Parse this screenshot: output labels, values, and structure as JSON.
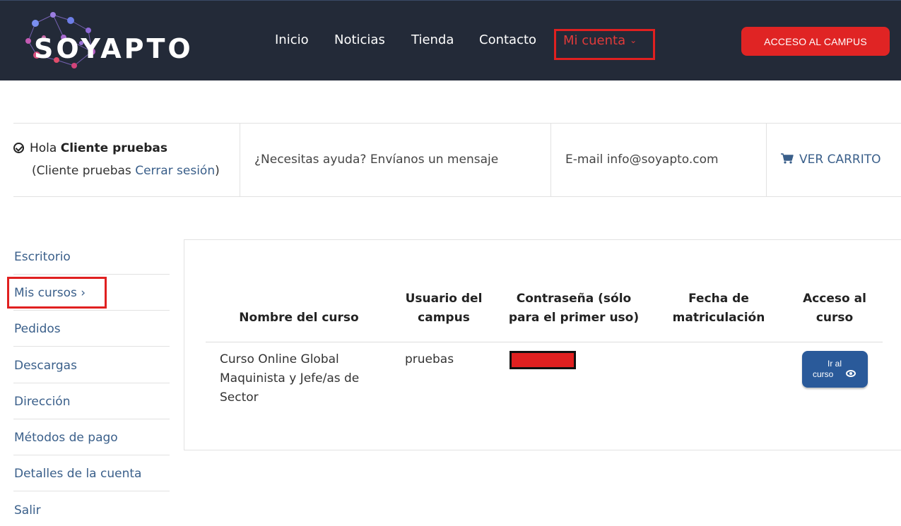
{
  "header": {
    "logo_text": "SOYAPTO",
    "nav": [
      "Inicio",
      "Noticias",
      "Tienda",
      "Contacto"
    ],
    "account_label": "Mi cuenta",
    "campus_button": "ACCESO AL CAMPUS",
    "colors": {
      "background": "#232a38",
      "accent": "#e02424"
    }
  },
  "infobar": {
    "hello_prefix": "Hola",
    "user_name": "Cliente pruebas",
    "sub_prefix": "(Cliente pruebas",
    "logout_link": "Cerrar sesión",
    "sub_suffix": ")",
    "help_text": "¿Necesitas ayuda? Envíanos un mensaje",
    "email_text": "E-mail info@soyapto.com",
    "cart_label": "VER CARRITO"
  },
  "sidebar": {
    "items": [
      {
        "label": "Escritorio"
      },
      {
        "label": "Mis cursos ›"
      },
      {
        "label": "Pedidos"
      },
      {
        "label": "Descargas"
      },
      {
        "label": "Dirección"
      },
      {
        "label": "Métodos de pago"
      },
      {
        "label": "Detalles de la cuenta"
      },
      {
        "label": "Salir"
      }
    ]
  },
  "table": {
    "headers": [
      {
        "line1": "Nombre del curso",
        "line2": ""
      },
      {
        "line1": "Usuario del",
        "line2": "campus"
      },
      {
        "line1": "Contraseña (sólo",
        "line2": "para el primer uso)"
      },
      {
        "line1": "Fecha de",
        "line2": "matriculación"
      },
      {
        "line1": "Acceso al",
        "line2": "curso"
      }
    ],
    "rows": [
      {
        "course_line1": "Curso Online Global",
        "course_line2": "Maquinista y Jefe/as de",
        "course_line3": "Sector",
        "user": "pruebas",
        "password": "",
        "date": "",
        "access_button_line1": "Ir al",
        "access_button_line2": "curso"
      }
    ]
  }
}
